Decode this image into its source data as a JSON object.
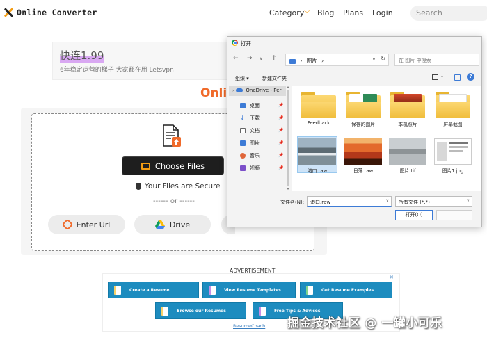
{
  "header": {
    "logo_text": "Online Converter",
    "nav": {
      "category": "Category",
      "blog": "Blog",
      "plans": "Plans",
      "login": "Login"
    },
    "search_placeholder": "Search"
  },
  "ad_top": {
    "title": "快连1.99",
    "subtitle": "6年稳定运营的梯子 大家都在用 Letsvpn"
  },
  "page_heading_visible": "Onlin",
  "upload": {
    "choose_label": "Choose Files",
    "secure_label": "Your Files are Secure",
    "or_label": "------ or ------",
    "enter_url_label": "Enter Url",
    "drive_label": "Drive"
  },
  "ads_bottom": {
    "label": "ADVERTISEMENT",
    "close": "✕",
    "buttons": [
      "Create a Resume",
      "View Resume Templates",
      "Get Resume Examples",
      "Browse our Resumes",
      "Free Tips & Advices"
    ],
    "footer": "ResumeCoach"
  },
  "watermark": "掘金技术社区 @ 一罐小可乐",
  "dialog": {
    "title": "打开",
    "address": "图片",
    "address_sep": "›",
    "search_placeholder": "在 图片 中搜索",
    "toolbar": {
      "organize": "组织 ▾",
      "new_folder": "新建文件夹"
    },
    "sidebar": {
      "onedrive": "OneDrive - Per",
      "items": [
        "桌面",
        "下载",
        "文档",
        "图片",
        "音乐",
        "视频"
      ]
    },
    "files": [
      {
        "name": "Feedback",
        "kind": "folder"
      },
      {
        "name": "保存的图片",
        "kind": "folder"
      },
      {
        "name": "本机照片",
        "kind": "folder"
      },
      {
        "name": "屏幕截图",
        "kind": "folder"
      },
      {
        "name": "港口.raw",
        "kind": "image",
        "selected": true
      },
      {
        "name": "日落.raw",
        "kind": "image"
      },
      {
        "name": "图片.tif",
        "kind": "image"
      },
      {
        "name": "图片1.jpg",
        "kind": "image"
      }
    ],
    "filename_label": "文件名(N):",
    "filename_value": "港口.raw",
    "filetype_value": "所有文件 (*.*)",
    "open_label": "打开(O)"
  },
  "colors": {
    "accent_orange": "#f06a2a",
    "logo_orange": "#f39c12",
    "ad_blue": "#1d8cbf",
    "dialog_blue": "#3d7bd6"
  }
}
